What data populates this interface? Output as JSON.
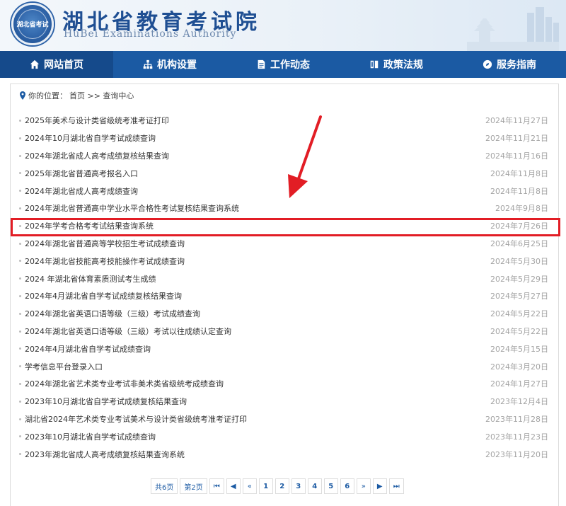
{
  "header": {
    "logo_text": "湖北省考试",
    "title": "湖北省教育考试院",
    "subtitle": "HuBei Examinations Authority"
  },
  "nav": {
    "items": [
      {
        "label": "网站首页",
        "icon": "home-icon"
      },
      {
        "label": "机构设置",
        "icon": "org-chart-icon"
      },
      {
        "label": "工作动态",
        "icon": "document-icon"
      },
      {
        "label": "政策法规",
        "icon": "book-icon"
      },
      {
        "label": "服务指南",
        "icon": "compass-icon"
      }
    ],
    "active_index": 0
  },
  "breadcrumb": {
    "prefix": "你的位置：",
    "path": "首页 >> 查询中心"
  },
  "list": [
    {
      "title": "2025年美术与设计类省级统考准考证打印",
      "date": "2024年11月27日"
    },
    {
      "title": "2024年10月湖北省自学考试成绩查询",
      "date": "2024年11月21日"
    },
    {
      "title": "2024年湖北省成人高考成绩复核结果查询",
      "date": "2024年11月16日"
    },
    {
      "title": "2025年湖北省普通高考报名入口",
      "date": "2024年11月8日"
    },
    {
      "title": "2024年湖北省成人高考成绩查询",
      "date": "2024年11月8日"
    },
    {
      "title": "2024年湖北省普通高中学业水平合格性考试复核结果查询系统",
      "date": "2024年9月8日"
    },
    {
      "title": "2024年学考合格考考试结果查询系统",
      "date": "2024年7月26日"
    },
    {
      "title": "2024年湖北省普通高等学校招生考试成绩查询",
      "date": "2024年6月25日"
    },
    {
      "title": "2024年湖北省技能高考技能操作考试成绩查询",
      "date": "2024年5月30日"
    },
    {
      "title": "2024 年湖北省体育素质测试考生成绩",
      "date": "2024年5月29日"
    },
    {
      "title": "2024年4月湖北省自学考试成绩复核结果查询",
      "date": "2024年5月27日"
    },
    {
      "title": "2024年湖北省英语口语等级（三级）考试成绩查询",
      "date": "2024年5月22日"
    },
    {
      "title": "2024年湖北省英语口语等级（三级）考试以往成绩认定查询",
      "date": "2024年5月22日"
    },
    {
      "title": "2024年4月湖北省自学考试成绩查询",
      "date": "2024年5月15日"
    },
    {
      "title": "学考信息平台登录入口",
      "date": "2024年3月20日"
    },
    {
      "title": "2024年湖北省艺术类专业考试非美术类省级统考成绩查询",
      "date": "2024年1月27日"
    },
    {
      "title": "2023年10月湖北省自学考试成绩复核结果查询",
      "date": "2023年12月4日"
    },
    {
      "title": "湖北省2024年艺术类专业考试美术与设计类省级统考准考证打印",
      "date": "2023年11月28日"
    },
    {
      "title": "2023年10月湖北省自学考试成绩查询",
      "date": "2023年11月23日"
    },
    {
      "title": "2023年湖北省成人高考成绩复核结果查询系统",
      "date": "2023年11月20日"
    }
  ],
  "highlighted_index": 6,
  "pagination": {
    "total": "共6页",
    "current": "第2页",
    "first": "⏮",
    "prev": "◀",
    "prev_group": "«",
    "pages": [
      "1",
      "2",
      "3",
      "4",
      "5",
      "6"
    ],
    "next_group": "»",
    "next": "▶",
    "last": "⏭"
  },
  "colors": {
    "nav_bg": "#1b5aa3",
    "highlight": "#e21d25"
  }
}
